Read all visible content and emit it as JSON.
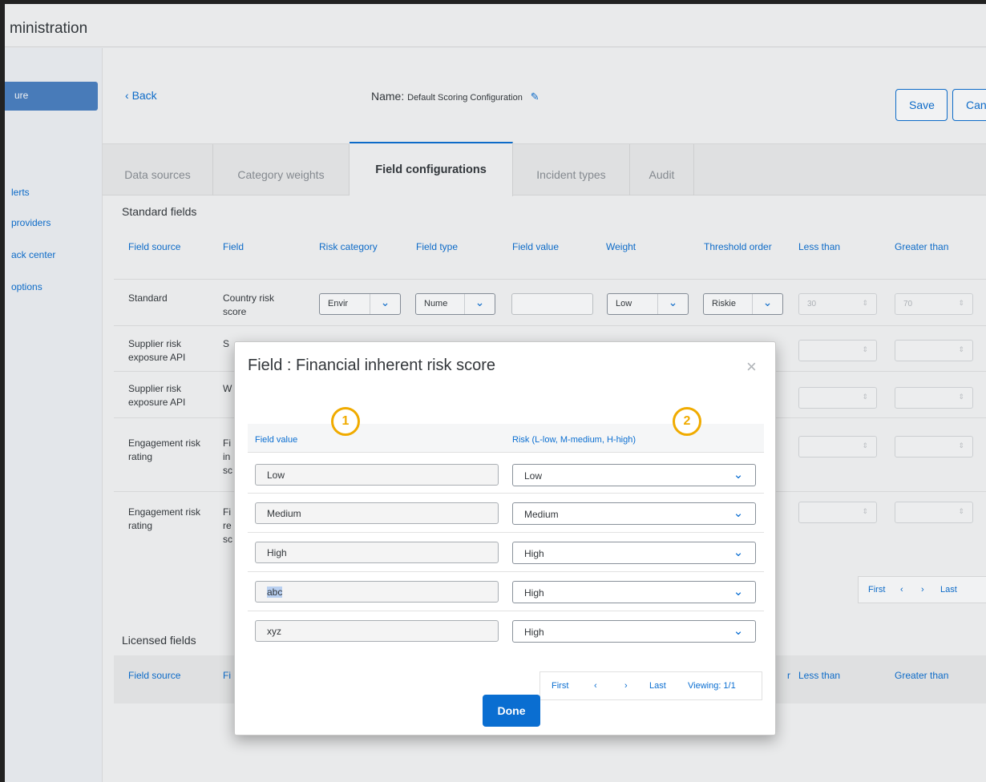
{
  "app": {
    "title": "ministration"
  },
  "sidebar": {
    "items": [
      {
        "label": "ure",
        "active": true
      },
      {
        "label": "lerts"
      },
      {
        "label": "providers"
      },
      {
        "label": "ack center"
      },
      {
        "label": " options"
      }
    ]
  },
  "header": {
    "back_label": "Back",
    "name_label": "Name:",
    "name_value": "Default Scoring Configuration",
    "save_label": "Save",
    "cancel_label": "Canc"
  },
  "tabs": [
    {
      "label": "Data sources"
    },
    {
      "label": "Category weights"
    },
    {
      "label": "Field configurations",
      "active": true
    },
    {
      "label": "Incident types"
    },
    {
      "label": "Audit"
    }
  ],
  "standard": {
    "title": "Standard fields",
    "columns": [
      "Field source",
      "Field",
      "Risk category",
      "Field type",
      "Field value",
      "Weight",
      "Threshold order",
      "Less than",
      "Greater than"
    ],
    "rows": [
      {
        "source": "Standard",
        "field": "Country risk score",
        "risk_category": "Envir",
        "field_type": "Nume",
        "weight": "Low",
        "threshold": "Riskie",
        "less_than": "30",
        "greater_than": "70"
      },
      {
        "source": "Supplier risk exposure API",
        "field": "S"
      },
      {
        "source": "Supplier risk exposure API",
        "field": "W"
      },
      {
        "source": "Engagement risk rating",
        "field": "Fi in sc"
      },
      {
        "source": "Engagement risk rating",
        "field": "Fi re sc"
      }
    ],
    "pager": {
      "first": "First",
      "prev": "‹",
      "next": "›",
      "last": "Last"
    }
  },
  "licensed": {
    "title": "Licensed fields",
    "columns": [
      "Field source",
      "Fi",
      "r",
      "Less than",
      "Greater than"
    ]
  },
  "dialog": {
    "title": "Field : Financial inherent risk score",
    "close": "×",
    "badge1": "1",
    "badge2": "2",
    "col_value": "Field value",
    "col_risk": "Risk (L-low, M-medium, H-high)",
    "rows": [
      {
        "value": "Low",
        "risk": "Low"
      },
      {
        "value": "Medium",
        "risk": "Medium"
      },
      {
        "value": "High",
        "risk": "High"
      },
      {
        "value": "abc",
        "risk": "High"
      },
      {
        "value": "xyz",
        "risk": "High"
      }
    ],
    "pager": {
      "first": "First",
      "prev": "‹",
      "next": "›",
      "last": "Last",
      "viewing": "Viewing: 1/1"
    },
    "done_label": "Done"
  },
  "colors": {
    "accent": "#0a6ed1",
    "badge": "#f0ab00",
    "sidebar_active": "#4a7fc1"
  }
}
